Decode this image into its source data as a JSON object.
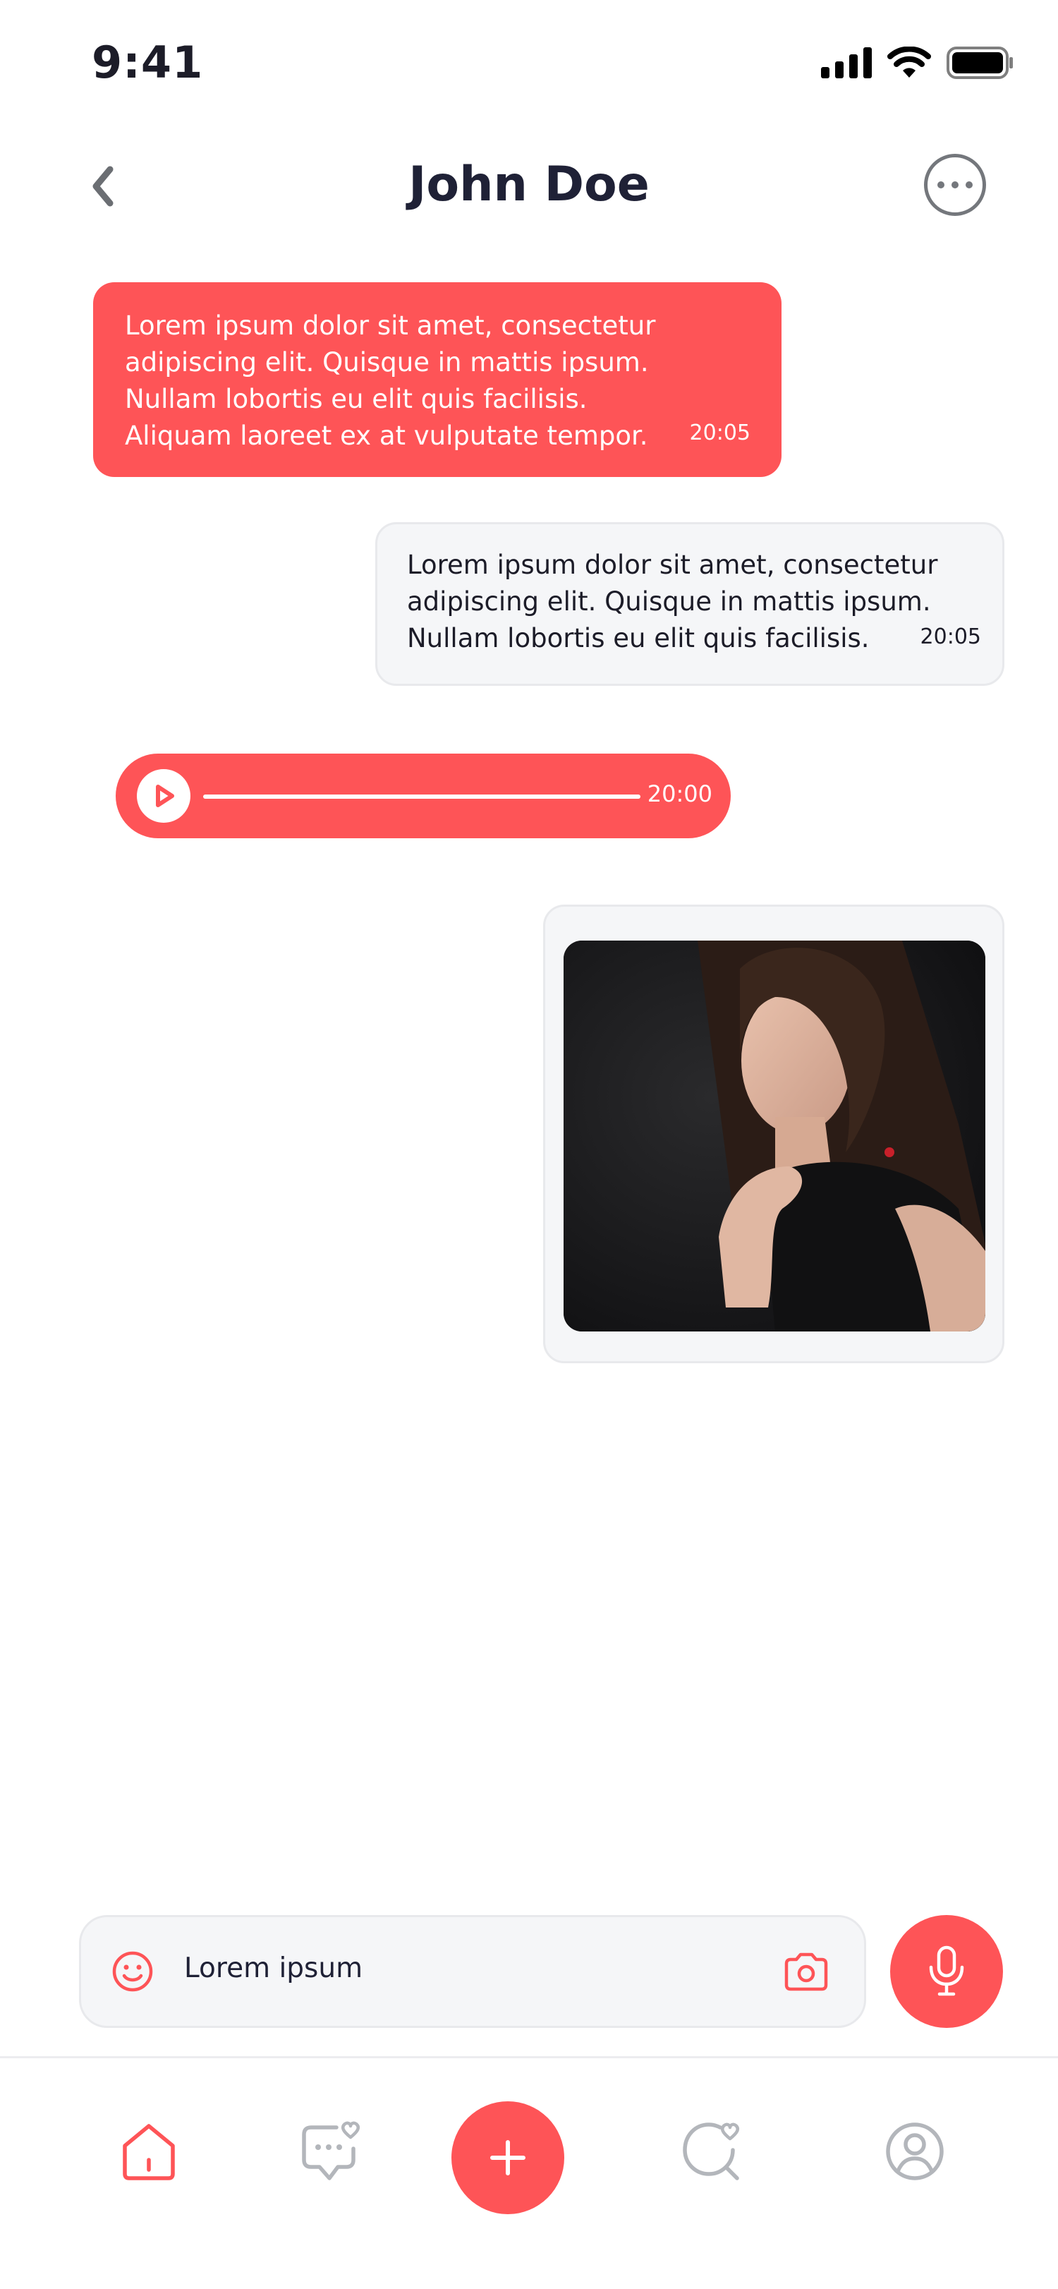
{
  "status_bar": {
    "time": "9:41"
  },
  "header": {
    "title": "John Doe"
  },
  "messages": {
    "received": {
      "text": "Lorem ipsum dolor sit amet, consectetur\nadipiscing elit. Quisque in mattis ipsum.\nNullam lobortis eu elit quis facilisis.\nAliquam laoreet ex at vulputate tempor.",
      "time": "20:05"
    },
    "sent": {
      "text": "Lorem ipsum dolor sit amet, consectetur\nadipiscing elit. Quisque in mattis ipsum.\nNullam lobortis eu elit quis facilisis.",
      "time": "20:05"
    },
    "voice": {
      "time": "20:00"
    }
  },
  "composer": {
    "text": "Lorem ipsum"
  },
  "colors": {
    "accent": "#fe5457",
    "bubble_sent": "#f5f6f8",
    "text_dark": "#1f2136",
    "icon_gray": "#74777c"
  },
  "icons": [
    "back-icon",
    "more-icon",
    "play-icon",
    "smile-icon",
    "camera-icon",
    "mic-icon",
    "home-icon",
    "chat-heart-icon",
    "plus-icon",
    "search-heart-icon",
    "profile-icon"
  ]
}
